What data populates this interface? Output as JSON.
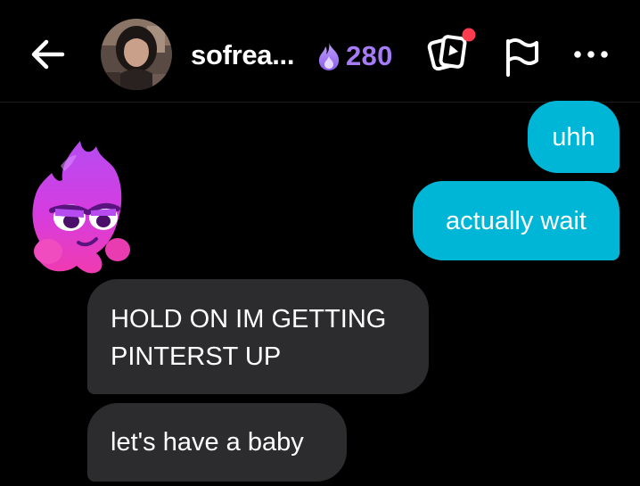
{
  "header": {
    "username": "sofrea...",
    "streak_count": "280",
    "icons": {
      "back": "arrow-left-icon",
      "streak": "flame-icon",
      "cards": "cards-play-icon",
      "flag": "flag-icon",
      "more": "more-horizontal-icon"
    },
    "notification_color": "#ff3b4f"
  },
  "messages": [
    {
      "from": "me",
      "text": "uhh"
    },
    {
      "from": "me",
      "text": "actually wait"
    },
    {
      "from": "them",
      "text": "HOLD ON IM GETTING PINTERST UP"
    },
    {
      "from": "them",
      "text": "let's have a baby"
    }
  ],
  "colors": {
    "outgoing_bubble": "#00b6d6",
    "incoming_bubble": "#2c2c2e",
    "streak": "#a57cf5",
    "background": "#000000"
  }
}
